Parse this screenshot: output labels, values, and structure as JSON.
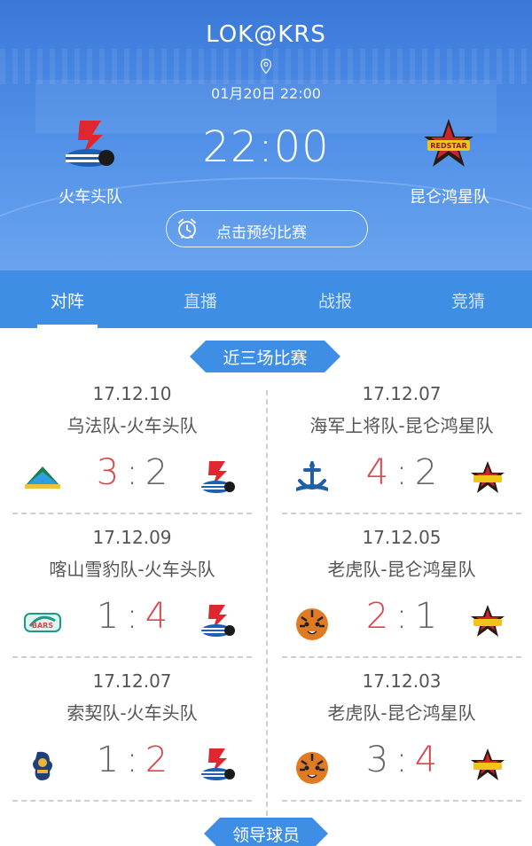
{
  "header": {
    "title": "LOK@KRS",
    "datetime": "01月20日 22:00",
    "time": "22:00",
    "home_team": "火车头队",
    "away_team": "昆仑鸿星队",
    "reserve_label": "点击预约比赛"
  },
  "tabs": [
    "对阵",
    "直播",
    "战报",
    "竞猜"
  ],
  "section_recent": "近三场比赛",
  "section_leaders": "领导球员",
  "left_matches": [
    {
      "date": "17.12.10",
      "teams": "乌法队-火车头队",
      "s1": "3",
      "s2": "2",
      "win": "left",
      "logo_l": "salavat-icon",
      "logo_r": "lokomotiv-icon"
    },
    {
      "date": "17.12.09",
      "teams": "喀山雪豹队-火车头队",
      "s1": "1",
      "s2": "4",
      "win": "right",
      "logo_l": "ak-bars-icon",
      "logo_r": "lokomotiv-icon"
    },
    {
      "date": "17.12.07",
      "teams": "索契队-火车头队",
      "s1": "1",
      "s2": "2",
      "win": "right",
      "logo_l": "sochi-icon",
      "logo_r": "lokomotiv-icon"
    }
  ],
  "right_matches": [
    {
      "date": "17.12.07",
      "teams": "海军上将队-昆仑鸿星队",
      "s1": "4",
      "s2": "2",
      "win": "left",
      "logo_l": "admiral-icon",
      "logo_r": "red-star-icon"
    },
    {
      "date": "17.12.05",
      "teams": "老虎队-昆仑鸿星队",
      "s1": "2",
      "s2": "1",
      "win": "left",
      "logo_l": "tiger-icon",
      "logo_r": "red-star-icon"
    },
    {
      "date": "17.12.03",
      "teams": "老虎队-昆仑鸿星队",
      "s1": "3",
      "s2": "4",
      "win": "right",
      "logo_l": "tiger-icon",
      "logo_r": "red-star-icon"
    }
  ],
  "colors": {
    "accent": "#3f8ee6",
    "win": "#d9474e"
  }
}
